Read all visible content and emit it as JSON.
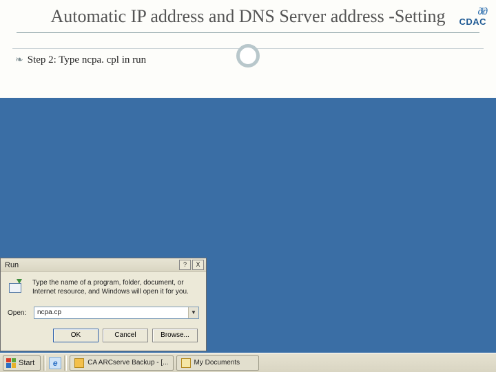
{
  "slide": {
    "title": "Automatic IP address and DNS Server address -Setting",
    "step": "Step 2: Type ncpa. cpl in run"
  },
  "logo": {
    "brand": "CDAC",
    "swirl": "∂ℓ∂"
  },
  "run_dialog": {
    "title": "Run",
    "help_label": "?",
    "close_label": "X",
    "description": "Type the name of a program, folder, document, or Internet resource, and Windows will open it for you.",
    "open_label": "Open:",
    "input_value": "ncpa.cp",
    "ok": "OK",
    "cancel": "Cancel",
    "browse": "Browse..."
  },
  "taskbar": {
    "start": "Start",
    "items": [
      {
        "label": "CA ARCserve Backup - [..."
      },
      {
        "label": "My Documents"
      }
    ]
  }
}
